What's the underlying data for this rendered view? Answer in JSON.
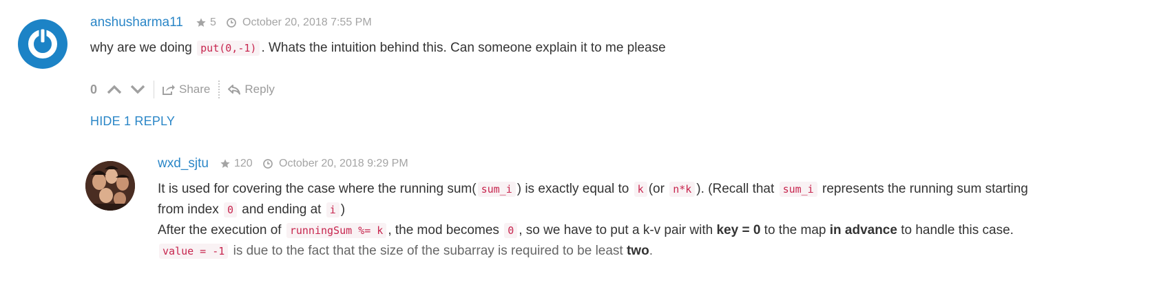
{
  "comment": {
    "username": "anshusharma11",
    "reputation": "5",
    "timestamp": "October 20, 2018 7:55 PM",
    "body": {
      "t1": "why are we doing",
      "c1": "put(0,-1)",
      "t2": ". Whats the intuition behind this. Can someone explain it to me please"
    },
    "votes": "0",
    "share_label": "Share",
    "reply_label": "Reply",
    "hide_replies_label": "HIDE 1 REPLY"
  },
  "reply": {
    "username": "wxd_sjtu",
    "reputation": "120",
    "timestamp": "October 20, 2018 9:29 PM",
    "p1": {
      "t1": "It is used for covering the case where the running sum(",
      "c1": "sum_i",
      "t2": ") is exactly equal to",
      "c2": "k",
      "t3": "(or",
      "c3": "n*k",
      "t4": "). (Recall that",
      "c4": "sum_i",
      "t5": "represents the running sum starting"
    },
    "p2": {
      "t1": "from index",
      "c1": "0",
      "t2": "and ending at",
      "c2": "i",
      "t3": ")"
    },
    "p3": {
      "t1": "After the execution of",
      "c1": "runningSum %= k",
      "t2": ", the mod becomes",
      "c2": "0",
      "t3": ", so we have to put a k-v pair with",
      "b1": "key = 0",
      "t4": "to the map",
      "b2": "in advance",
      "t5": "to handle this case."
    },
    "p4": {
      "c1": "value = -1",
      "t1": "is due to the fact that the size of the subarray is required to be least",
      "b1": "two",
      "t2": "."
    }
  },
  "colors": {
    "link": "#2a86c7",
    "code_text": "#c7254e",
    "code_bg": "#f9f2f4",
    "avatar_blue": "#1c83c6"
  }
}
